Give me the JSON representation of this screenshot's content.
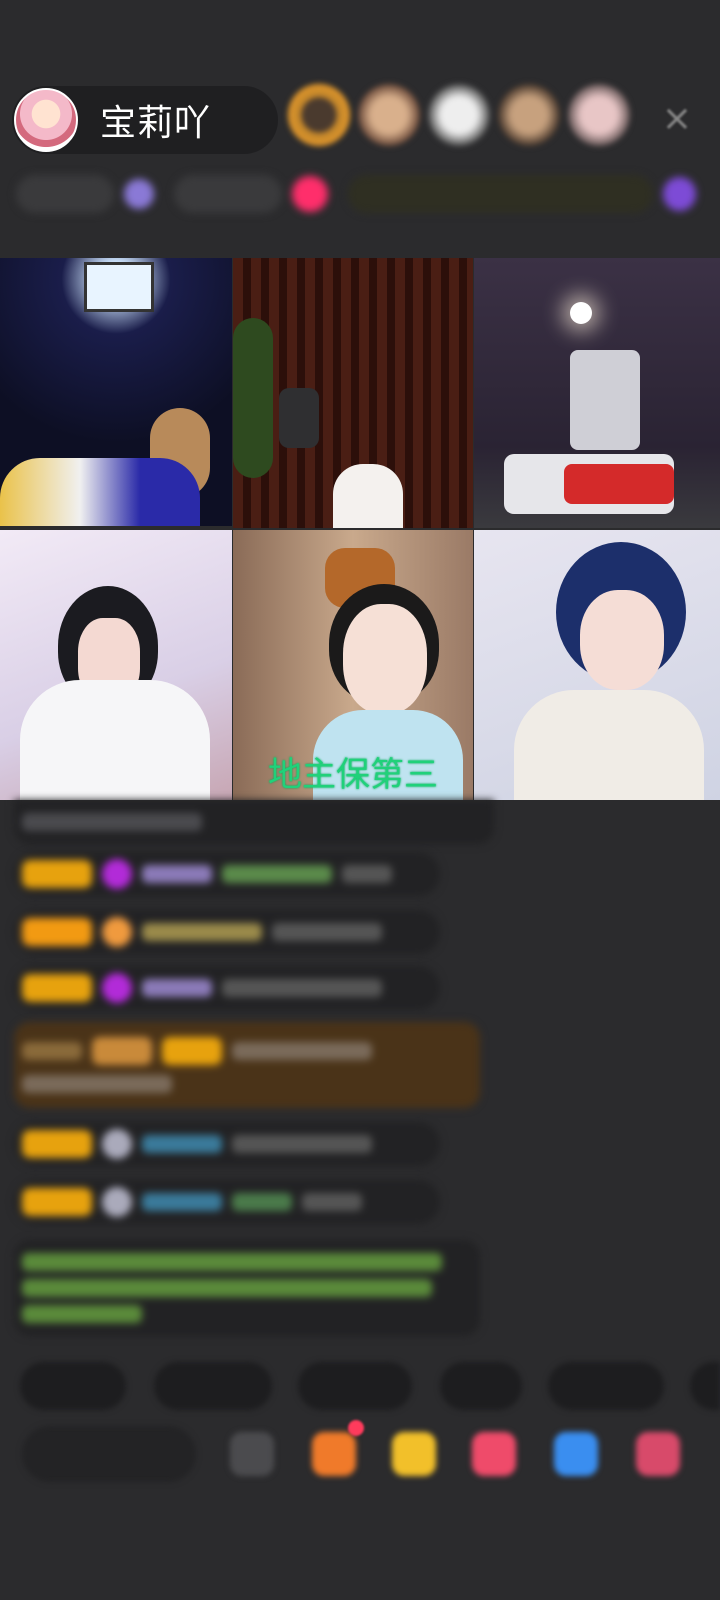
{
  "header": {
    "host_name": "宝莉吖"
  },
  "video_grid": {
    "tiles": [
      {
        "label": ""
      },
      {
        "label": ""
      },
      {
        "label": ""
      },
      {
        "label": ""
      },
      {
        "label": "地主保第三"
      },
      {
        "label": ""
      }
    ]
  },
  "colors": {
    "background": "#2b2b2d",
    "badge_gold": "#e7a20e",
    "label_green": "#20d17a"
  }
}
